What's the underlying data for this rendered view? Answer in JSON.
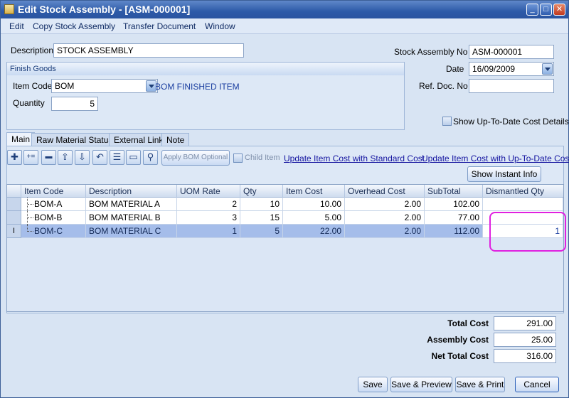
{
  "window": {
    "title": "Edit Stock Assembly  - [ASM-000001]",
    "controls": {
      "minimize": "_",
      "restore": "□",
      "close": "✕"
    }
  },
  "menu": [
    "Edit",
    "Copy Stock Assembly",
    "Transfer Document",
    "Window"
  ],
  "header": {
    "description_label": "Description",
    "description_value": "STOCK ASSEMBLY",
    "stock_assembly_no_label": "Stock Assembly No",
    "stock_assembly_no_value": "ASM-000001",
    "date_label": "Date",
    "date_value": "16/09/2009",
    "ref_doc_no_label": "Ref. Doc. No",
    "ref_doc_no_value": "",
    "show_cost_details_label": "Show Up-To-Date Cost Details"
  },
  "finish_goods": {
    "title": "Finish Goods",
    "item_code_label": "Item Code",
    "item_code_value": "BOM",
    "item_description": "BOM FINISHED ITEM",
    "quantity_label": "Quantity",
    "quantity_value": "5"
  },
  "tabs": [
    "Main",
    "Raw Material Status",
    "External Link",
    "Note"
  ],
  "toolbar": {
    "apply_bom_optional": "Apply BOM Optional",
    "child_item": "Child Item",
    "update_standard_cost": "Update Item Cost with Standard Cost",
    "update_uptodate_cost": "Update Item Cost with Up-To-Date Cost",
    "show_instant_info": "Show Instant Info",
    "icons": [
      "plus-icon",
      "insert-row-icon",
      "minus-icon",
      "move-up-icon",
      "move-down-icon",
      "undo-icon",
      "list-icon",
      "detail-icon",
      "search-icon"
    ],
    "glyphs": [
      "✚",
      "+=",
      "▬",
      "⇧",
      "⇩",
      "↶",
      "☰",
      "▭",
      "⚲"
    ]
  },
  "grid": {
    "columns": [
      "Item Code",
      "Description",
      "UOM Rate",
      "Qty",
      "Item Cost",
      "Overhead Cost",
      "SubTotal",
      "Dismantled Qty"
    ],
    "rows": [
      {
        "item_code": "BOM-A",
        "description": "BOM MATERIAL A",
        "uom_rate": "2",
        "qty": "10",
        "item_cost": "10.00",
        "overhead_cost": "2.00",
        "subtotal": "102.00",
        "dismantled_qty": ""
      },
      {
        "item_code": "BOM-B",
        "description": "BOM MATERIAL B",
        "uom_rate": "3",
        "qty": "15",
        "item_cost": "5.00",
        "overhead_cost": "2.00",
        "subtotal": "77.00",
        "dismantled_qty": ""
      },
      {
        "item_code": "BOM-C",
        "description": "BOM MATERIAL C",
        "uom_rate": "1",
        "qty": "5",
        "item_cost": "22.00",
        "overhead_cost": "2.00",
        "subtotal": "112.00",
        "dismantled_qty": "1"
      }
    ],
    "selected_row_indicator": "I"
  },
  "totals": {
    "total_cost_label": "Total Cost",
    "total_cost_value": "291.00",
    "assembly_cost_label": "Assembly Cost",
    "assembly_cost_value": "25.00",
    "net_total_cost_label": "Net Total Cost",
    "net_total_cost_value": "316.00"
  },
  "buttons": {
    "save": "Save",
    "save_preview": "Save & Preview",
    "save_print": "Save & Print",
    "cancel": "Cancel"
  },
  "colors": {
    "title_bar": "#2d5aa8",
    "selected_row": "#a5bdea",
    "highlight_annotation": "#e020e0",
    "link": "#1414a0"
  }
}
